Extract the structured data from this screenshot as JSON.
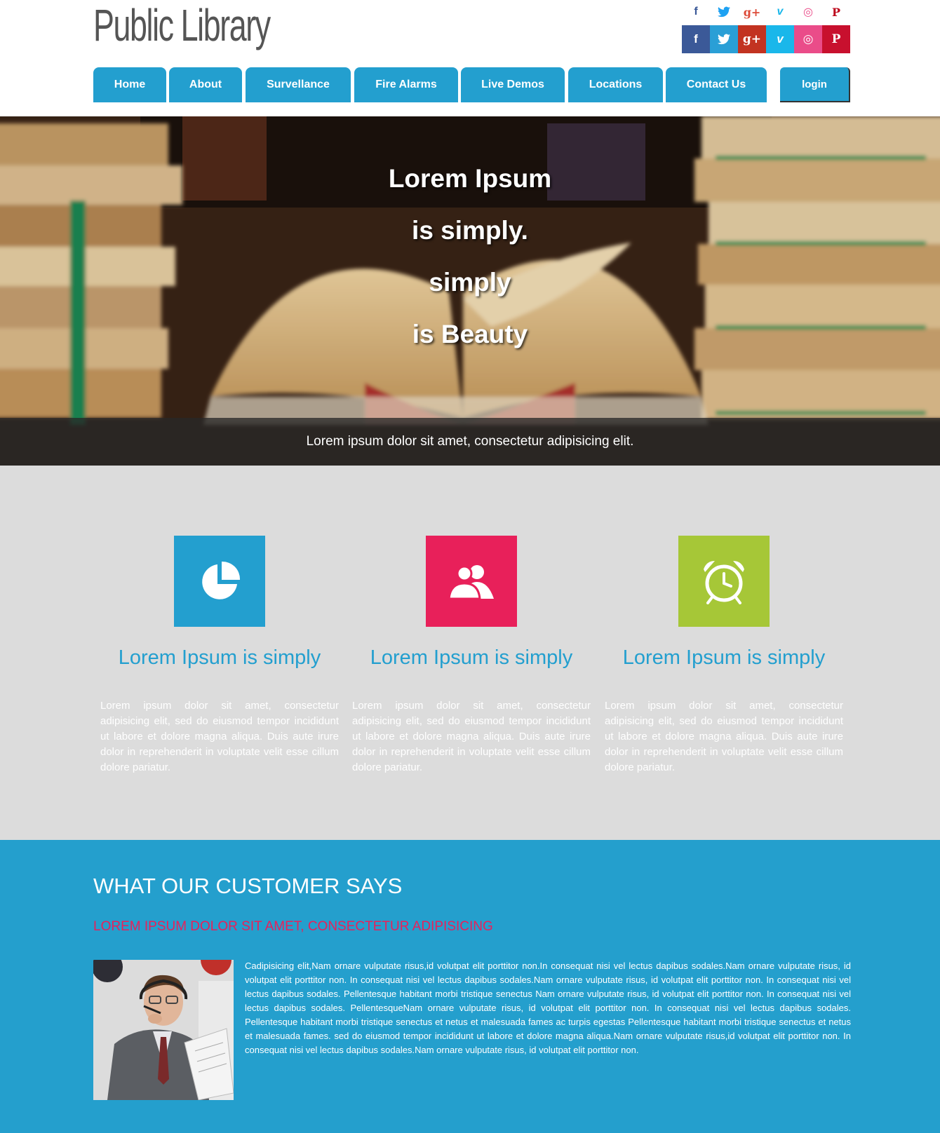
{
  "site": {
    "logo": "Public Library"
  },
  "social": {
    "small": [
      {
        "icon": "facebook-icon",
        "glyph": "f",
        "color": "#3b5998"
      },
      {
        "icon": "twitter-icon",
        "glyph": "🐦",
        "color": "#1da1f2"
      },
      {
        "icon": "google-plus-icon",
        "glyph": "g+",
        "color": "#dd4b39"
      },
      {
        "icon": "vimeo-icon",
        "glyph": "v",
        "color": "#1ab7ea"
      },
      {
        "icon": "dribbble-icon",
        "glyph": "◎",
        "color": "#ea4c89"
      },
      {
        "icon": "pinterest-icon",
        "glyph": "P",
        "color": "#bd081c"
      }
    ],
    "big": [
      {
        "icon": "facebook-icon",
        "glyph": "f",
        "bg": "#3b5998"
      },
      {
        "icon": "twitter-icon",
        "glyph": "🐦",
        "bg": "#2a9fd6"
      },
      {
        "icon": "google-plus-icon",
        "glyph": "g+",
        "bg": "#c23321"
      },
      {
        "icon": "vimeo-icon",
        "glyph": "v",
        "bg": "#1ab7ea"
      },
      {
        "icon": "dribbble-icon",
        "glyph": "◎",
        "bg": "#ea4c89"
      },
      {
        "icon": "pinterest-icon",
        "glyph": "P",
        "bg": "#c8102e"
      }
    ]
  },
  "nav": {
    "items": [
      "Home",
      "About",
      "Survellance",
      "Fire Alarms",
      "Live Demos",
      "Locations",
      "Contact Us"
    ],
    "login": "login",
    "color": "#239fcf"
  },
  "hero": {
    "lines": [
      "Lorem Ipsum",
      "is simply.",
      "simply",
      "is Beauty"
    ],
    "caption": "Lorem ipsum dolor sit amet, consectetur adipisicing elit."
  },
  "features": [
    {
      "icon": "pie-chart-icon",
      "color": "#239fcf",
      "title": "Lorem Ipsum is simply",
      "text": "Lorem ipsum dolor sit amet, consectetur adipisicing elit, sed do eiusmod tempor incididunt ut labore et dolore magna aliqua. Duis aute irure dolor in reprehenderit in voluptate velit esse cillum dolore pariatur."
    },
    {
      "icon": "users-icon",
      "color": "#e8205a",
      "title": "Lorem Ipsum is simply",
      "text": "Lorem ipsum dolor sit amet, consectetur adipisicing elit, sed do eiusmod tempor incididunt ut labore et dolore magna aliqua. Duis aute irure dolor in reprehenderit in voluptate velit esse cillum dolore pariatur."
    },
    {
      "icon": "alarm-clock-icon",
      "color": "#a6c737",
      "title": "Lorem Ipsum is simply",
      "text": "Lorem ipsum dolor sit amet, consectetur adipisicing elit, sed do eiusmod tempor incididunt ut labore et dolore magna aliqua. Duis aute irure dolor in reprehenderit in voluptate velit esse cillum dolore pariatur."
    }
  ],
  "testimonial": {
    "heading": "WHAT OUR CUSTOMER SAYS",
    "subheading": "LOREM IPSUM DOLOR SIT AMET, CONSECTETUR ADIPISICING",
    "quote": "Cadipisicing elit,Nam ornare vulputate risus,id volutpat elit porttitor non.In consequat nisi vel lectus dapibus sodales.Nam ornare vulputate risus, id volutpat elit porttitor non. In consequat nisi vel lectus dapibus sodales.Nam ornare vulputate risus, id volutpat elit porttitor non. In consequat nisi vel lectus dapibus sodales. Pellentesque habitant morbi tristique senectus Nam ornare vulputate risus, id volutpat elit porttitor non. In consequat nisi vel lectus dapibus sodales. PellentesqueNam ornare vulputate risus, id volutpat elit porttitor non. In consequat nisi vel lectus dapibus sodales. Pellentesque habitant morbi tristique senectus et netus et malesuada fames ac turpis egestas Pellentesque habitant morbi tristique senectus et netus et malesuada fames. sed do eiusmod tempor incididunt ut labore et dolore magna aliqua.Nam ornare vulputate risus,id volutpat elit porttitor non. In consequat nisi vel lectus dapibus sodales.Nam ornare vulputate risus, id volutpat elit porttitor non."
  }
}
